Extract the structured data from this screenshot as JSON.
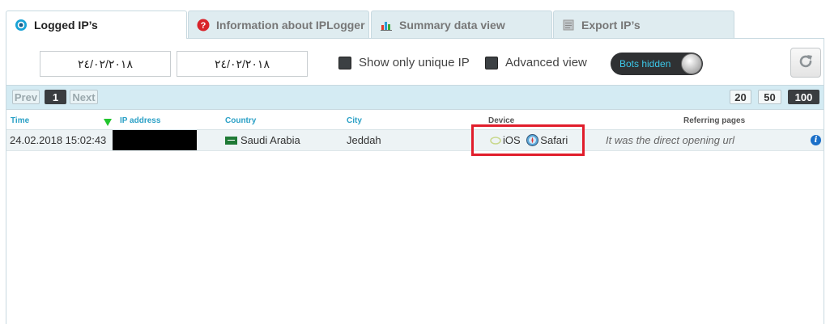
{
  "tabs": [
    {
      "label": "Logged IP’s",
      "icon": "eye-icon",
      "active": true
    },
    {
      "label": "Information about IPLogger",
      "icon": "question-icon",
      "active": false
    },
    {
      "label": "Summary data view",
      "icon": "bar-chart-icon",
      "active": false
    },
    {
      "label": "Export IP’s",
      "icon": "document-icon",
      "active": false
    }
  ],
  "filters": {
    "date_from": "٢٤/٠٢/٢٠١٨",
    "date_to": "٢٤/٠٢/٢٠١٨",
    "unique_ip_label": "Show only unique IP",
    "advanced_view_label": "Advanced view",
    "bots_toggle_label": "Bots hidden"
  },
  "pagination": {
    "prev": "Prev",
    "current_page": "1",
    "next": "Next",
    "page_sizes": [
      "20",
      "50",
      "100"
    ],
    "selected_page_size": "100"
  },
  "table": {
    "columns": [
      "Time",
      "IP address",
      "Country",
      "City",
      "Device",
      "Referring pages"
    ],
    "rows": [
      {
        "time": "24.02.2018 15:02:43",
        "ip": "",
        "country": "Saudi Arabia",
        "city": "Jeddah",
        "os": "iOS",
        "browser": "Safari",
        "referrer": "It was the direct opening url"
      }
    ]
  },
  "colors": {
    "accent": "#2aa0c6",
    "highlight": "#e11d2b",
    "toggle_bg": "#2f3133"
  }
}
